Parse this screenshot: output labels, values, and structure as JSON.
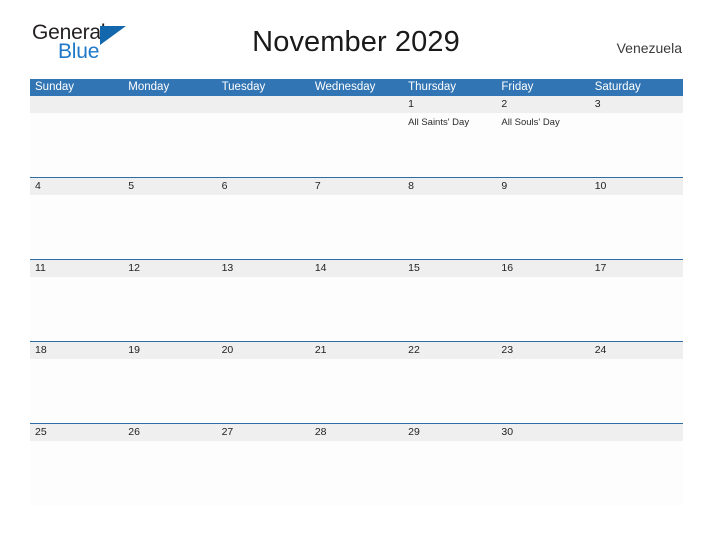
{
  "brand": {
    "name_part1": "General",
    "name_part2": "Blue",
    "triangle_icon": "triangle-icon",
    "accent_color": "#1368ad",
    "blue_text_color": "#1f78c8"
  },
  "header": {
    "title": "November 2029",
    "locale": "Venezuela"
  },
  "colors": {
    "header_blue": "#3275b4",
    "row_divider_blue": "#2e6da4",
    "date_band_gray": "#efefef",
    "title_text": "#1a1a1a"
  },
  "calendar": {
    "weekdays": [
      "Sunday",
      "Monday",
      "Tuesday",
      "Wednesday",
      "Thursday",
      "Friday",
      "Saturday"
    ],
    "weeks": [
      {
        "days": [
          {
            "date": "",
            "events": []
          },
          {
            "date": "",
            "events": []
          },
          {
            "date": "",
            "events": []
          },
          {
            "date": "",
            "events": []
          },
          {
            "date": "1",
            "events": [
              "All Saints' Day"
            ]
          },
          {
            "date": "2",
            "events": [
              "All Souls' Day"
            ]
          },
          {
            "date": "3",
            "events": []
          }
        ]
      },
      {
        "days": [
          {
            "date": "4",
            "events": []
          },
          {
            "date": "5",
            "events": []
          },
          {
            "date": "6",
            "events": []
          },
          {
            "date": "7",
            "events": []
          },
          {
            "date": "8",
            "events": []
          },
          {
            "date": "9",
            "events": []
          },
          {
            "date": "10",
            "events": []
          }
        ]
      },
      {
        "days": [
          {
            "date": "11",
            "events": []
          },
          {
            "date": "12",
            "events": []
          },
          {
            "date": "13",
            "events": []
          },
          {
            "date": "14",
            "events": []
          },
          {
            "date": "15",
            "events": []
          },
          {
            "date": "16",
            "events": []
          },
          {
            "date": "17",
            "events": []
          }
        ]
      },
      {
        "days": [
          {
            "date": "18",
            "events": []
          },
          {
            "date": "19",
            "events": []
          },
          {
            "date": "20",
            "events": []
          },
          {
            "date": "21",
            "events": []
          },
          {
            "date": "22",
            "events": []
          },
          {
            "date": "23",
            "events": []
          },
          {
            "date": "24",
            "events": []
          }
        ]
      },
      {
        "days": [
          {
            "date": "25",
            "events": []
          },
          {
            "date": "26",
            "events": []
          },
          {
            "date": "27",
            "events": []
          },
          {
            "date": "28",
            "events": []
          },
          {
            "date": "29",
            "events": []
          },
          {
            "date": "30",
            "events": []
          },
          {
            "date": "",
            "events": []
          }
        ]
      }
    ]
  }
}
